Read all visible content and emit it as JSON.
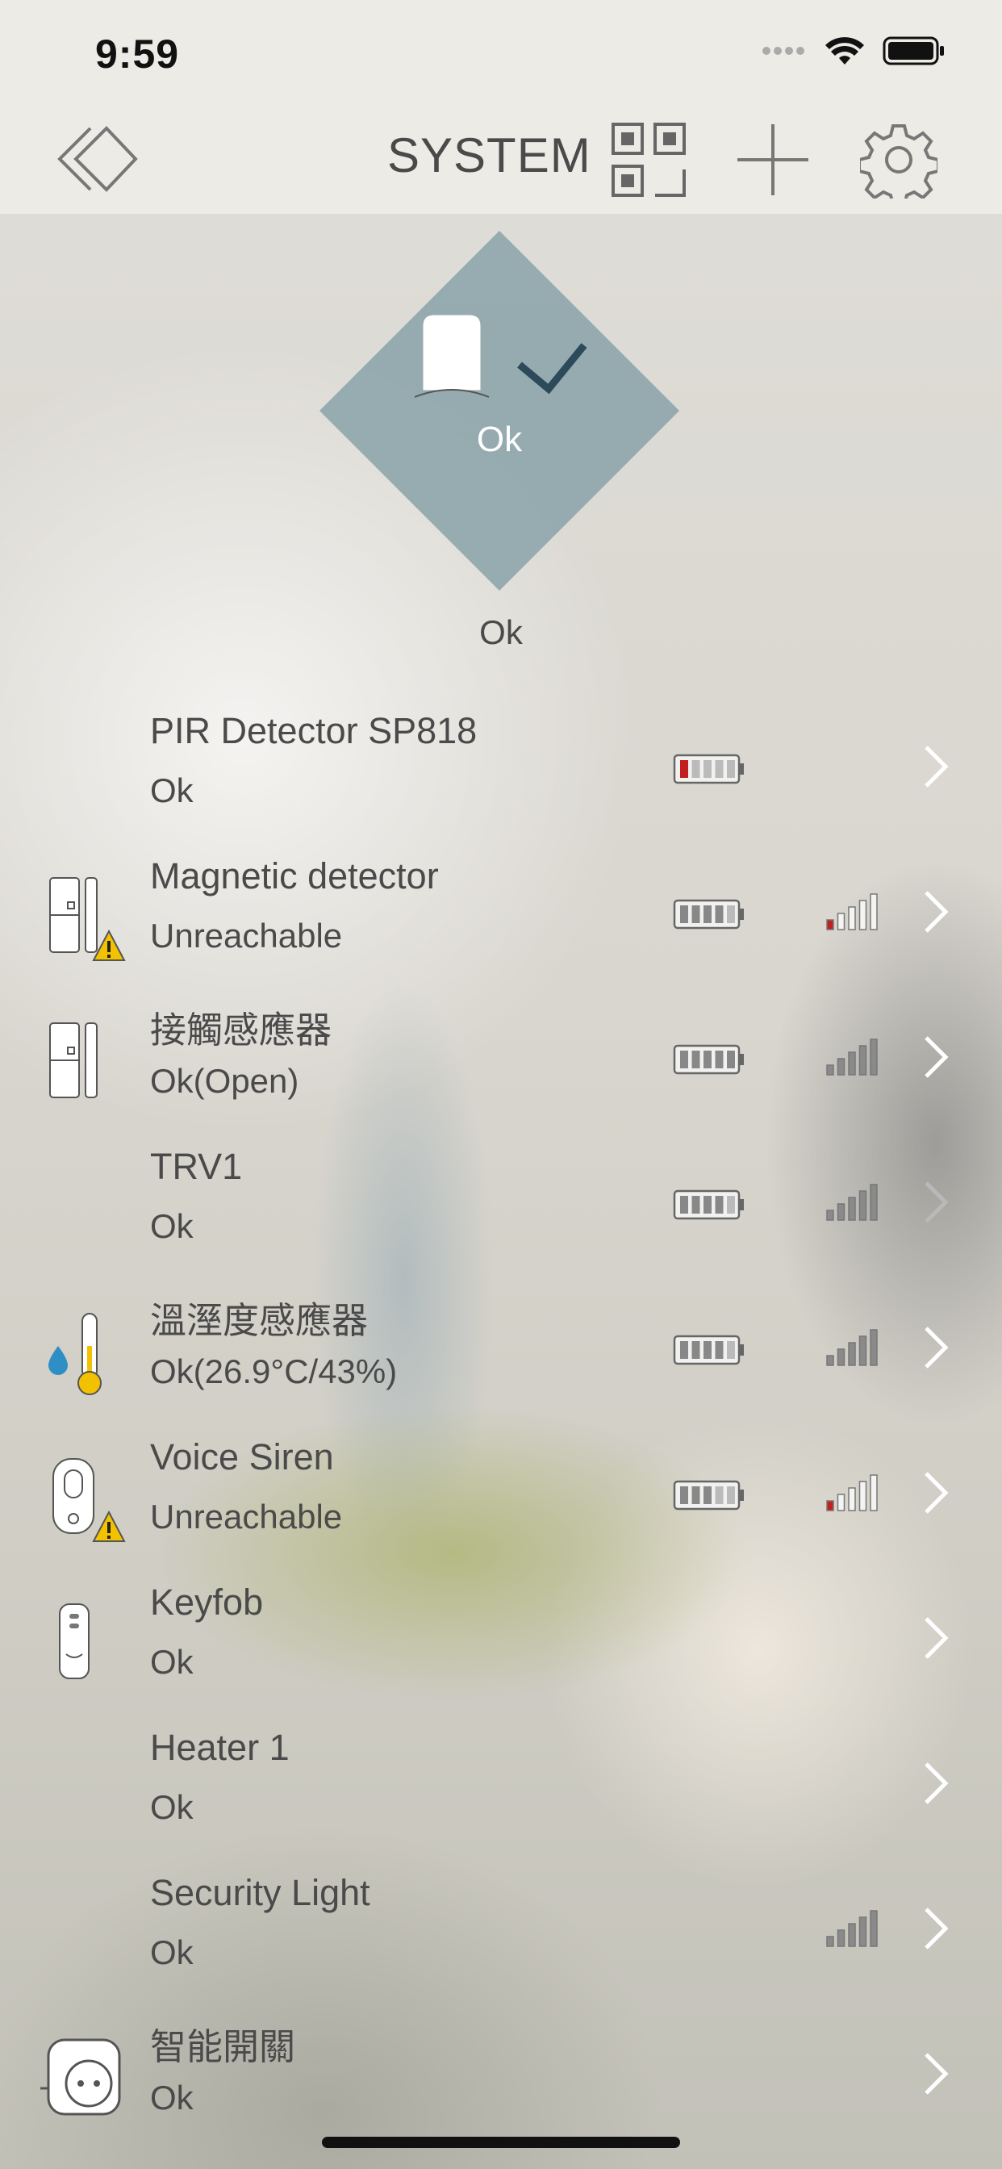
{
  "status_bar": {
    "time": "9:59"
  },
  "header": {
    "title": "SYSTEM"
  },
  "hero": {
    "badge_text": "Ok",
    "status": "Ok",
    "color": "#8fa7ac"
  },
  "devices": [
    {
      "name": "PIR Detector SP818",
      "status": "Ok",
      "icon": "pir-icon",
      "battery_bars": 1,
      "battery_low": true,
      "signal": null,
      "chevron_dim": false
    },
    {
      "name": "Magnetic detector",
      "status": "Unreachable",
      "icon": "door-contact-warning-icon",
      "battery_bars": 4,
      "battery_low": false,
      "signal": 1,
      "signal_low": true,
      "chevron_dim": false
    },
    {
      "name": "接觸感應器",
      "status": "Ok(Open)",
      "icon": "door-contact-icon",
      "battery_bars": 5,
      "battery_low": false,
      "signal": 5,
      "signal_low": false,
      "chevron_dim": false
    },
    {
      "name": "TRV1",
      "status": "Ok",
      "icon": "",
      "battery_bars": 4,
      "battery_low": false,
      "signal": 5,
      "signal_low": false,
      "chevron_dim": true
    },
    {
      "name": "溫溼度感應器",
      "status": "Ok(26.9°C/43%)",
      "icon": "thermo-humidity-icon",
      "battery_bars": 4,
      "battery_low": false,
      "signal": 5,
      "signal_low": false,
      "chevron_dim": false
    },
    {
      "name": "Voice Siren",
      "status": "Unreachable",
      "icon": "siren-warning-icon",
      "battery_bars": 3,
      "battery_low": false,
      "signal": 1,
      "signal_low": true,
      "chevron_dim": false
    },
    {
      "name": "Keyfob",
      "status": "Ok",
      "icon": "keyfob-icon",
      "battery_bars": null,
      "signal": null,
      "chevron_dim": false
    },
    {
      "name": "Heater 1",
      "status": "Ok",
      "icon": "",
      "battery_bars": null,
      "signal": null,
      "chevron_dim": false
    },
    {
      "name": "Security Light",
      "status": "Ok",
      "icon": "",
      "battery_bars": null,
      "signal": 5,
      "signal_low": false,
      "chevron_dim": false
    },
    {
      "name": "智能開關",
      "status": "Ok",
      "icon": "smart-plug-icon",
      "battery_bars": null,
      "signal": null,
      "chevron_dim": false
    }
  ],
  "colors": {
    "text": "#4a4a4a",
    "low": "#c0201f",
    "bar": "#8a8a8a"
  }
}
